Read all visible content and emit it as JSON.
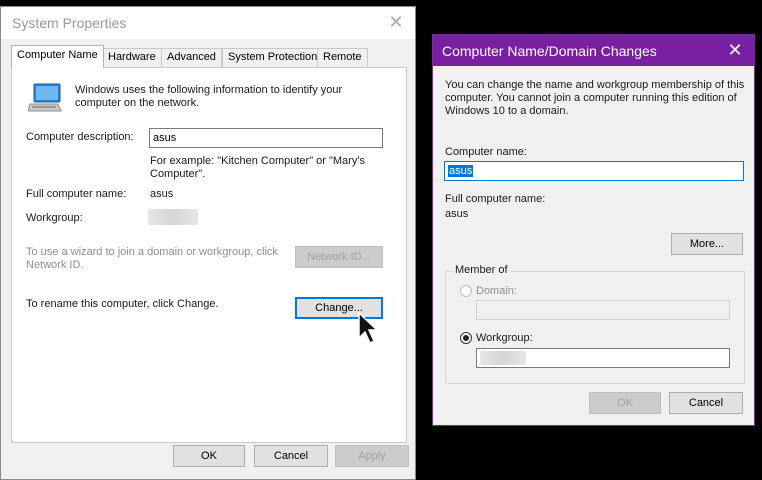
{
  "system_properties": {
    "title": "System Properties",
    "tabs": [
      {
        "label": "Computer Name",
        "active": true
      },
      {
        "label": "Hardware"
      },
      {
        "label": "Advanced"
      },
      {
        "label": "System Protection"
      },
      {
        "label": "Remote"
      }
    ],
    "intro_text": "Windows uses the following information to identify your computer on the network.",
    "description_label": "Computer description:",
    "description_value": "asus",
    "example_text": "For example: \"Kitchen Computer\" or \"Mary's Computer\".",
    "full_name_label": "Full computer name:",
    "full_name_value": "asus",
    "workgroup_label": "Workgroup:",
    "wizard_text": "To use a wizard to join a domain or workgroup, click Network ID.",
    "network_id_button": "Network ID...",
    "rename_text": "To rename this computer, click Change.",
    "change_button": "Change...",
    "ok_button": "OK",
    "cancel_button": "Cancel",
    "apply_button": "Apply"
  },
  "domain_changes": {
    "title": "Computer Name/Domain Changes",
    "intro_text": "You can change the name and workgroup membership of this computer. You cannot join a computer running this edition of Windows 10 to a domain.",
    "computer_name_label": "Computer name:",
    "computer_name_value": "asus",
    "full_name_label": "Full computer name:",
    "full_name_value": "asus",
    "more_button": "More...",
    "member_of_label": "Member of",
    "domain_label": "Domain:",
    "workgroup_label": "Workgroup:",
    "selected_option": "Workgroup",
    "ok_button": "OK",
    "cancel_button": "Cancel"
  },
  "colors": {
    "accent_purple": "#7a1fa2",
    "focus_blue": "#0078d7"
  }
}
